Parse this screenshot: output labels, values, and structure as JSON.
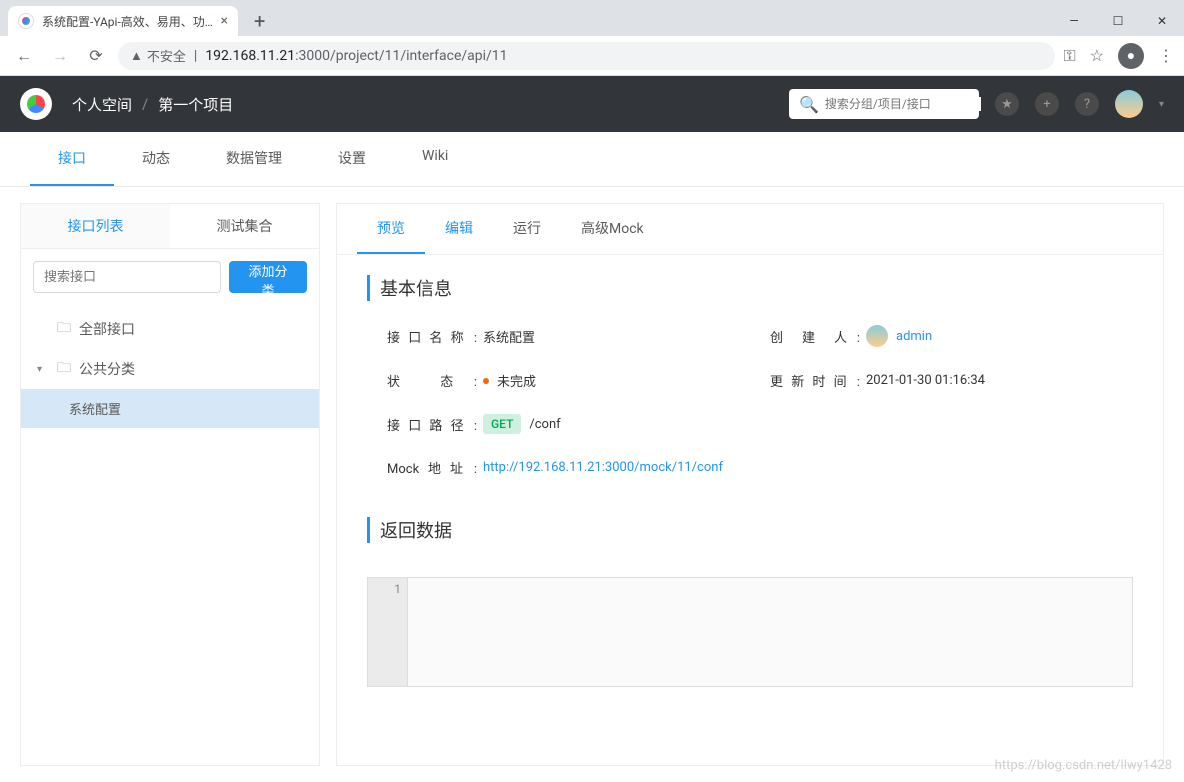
{
  "browser": {
    "tab_title": "系统配置-YApi-高效、易用、功能",
    "insecure_label": "不安全",
    "url_host": "192.168.11.21",
    "url_port_path": ":3000/project/11/interface/api/11"
  },
  "header": {
    "breadcrumb": [
      "个人空间",
      "第一个项目"
    ],
    "search_placeholder": "搜索分组/项目/接口"
  },
  "nav_tabs": [
    "接口",
    "动态",
    "数据管理",
    "设置",
    "Wiki"
  ],
  "nav_active": 0,
  "sidebar": {
    "tabs": [
      "接口列表",
      "测试集合"
    ],
    "active": 0,
    "search_placeholder": "搜索接口",
    "add_button": "添加分类",
    "tree": {
      "all": "全部接口",
      "category": "公共分类",
      "leaf": "系统配置"
    }
  },
  "content_tabs": [
    "预览",
    "编辑",
    "运行",
    "高级Mock"
  ],
  "content_active": 0,
  "sections": {
    "basic": "基本信息",
    "response": "返回数据"
  },
  "info": {
    "name_label": "接口名称",
    "name_value": "系统配置",
    "creator_label": "创 建 人",
    "creator_value": "admin",
    "status_label": "状    态",
    "status_value": "未完成",
    "updated_label": "更新时间",
    "updated_value": "2021-01-30 01:16:34",
    "path_label": "接口路径",
    "method": "GET",
    "path_value": "/conf",
    "mock_label": "Mock地址",
    "mock_url": "http://192.168.11.21:3000/mock/11/conf"
  },
  "code": {
    "line_number": "1"
  },
  "watermark": "https://blog.csdn.net/llwy1428"
}
